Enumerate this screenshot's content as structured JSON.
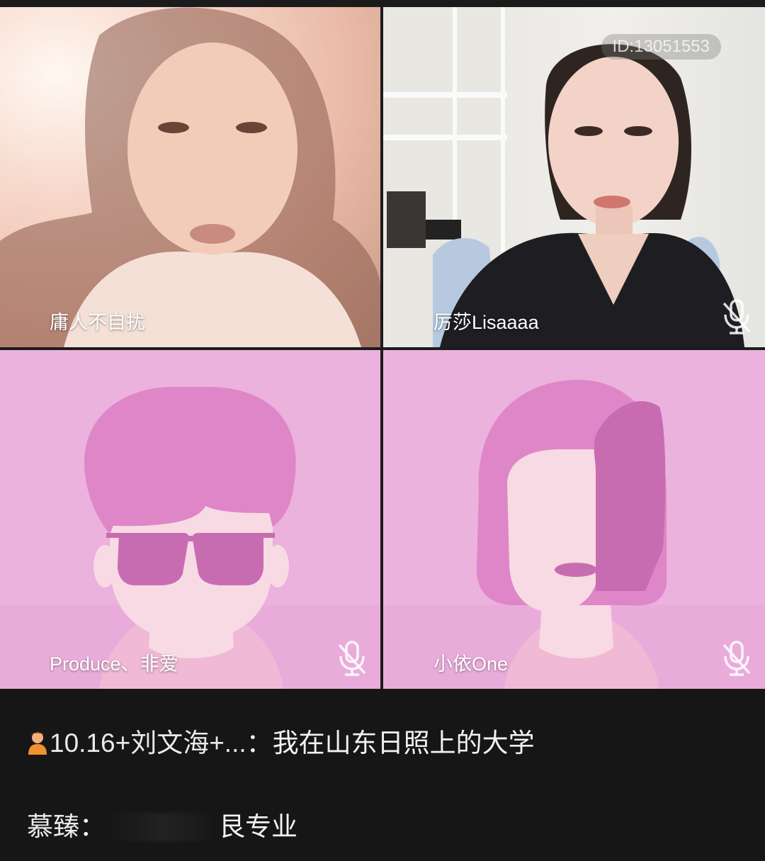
{
  "participants": [
    {
      "name": "庸人不自扰",
      "video": "camera",
      "muted": false
    },
    {
      "name": "厉莎Lisaaaa",
      "video": "camera",
      "muted": true,
      "id_badge": "ID:13051553"
    },
    {
      "name": "Produce、非爱",
      "video": "avatar-male-sunglasses",
      "muted": true
    },
    {
      "name": "小依One",
      "video": "avatar-female-bob",
      "muted": true
    }
  ],
  "chat": {
    "messages": [
      {
        "icon": "user-avatar-icon",
        "sender": "10.16+刘文海+...",
        "separator": "：",
        "text": "我在山东日照上的大学"
      },
      {
        "sender": "慕臻",
        "separator": "：",
        "text": "艮专业"
      }
    ]
  },
  "colors": {
    "avatar_bg": "#eab2dc",
    "avatar_hair": "#de86c8",
    "avatar_skin": "#f7dae3",
    "chat_bg": "#161616"
  }
}
